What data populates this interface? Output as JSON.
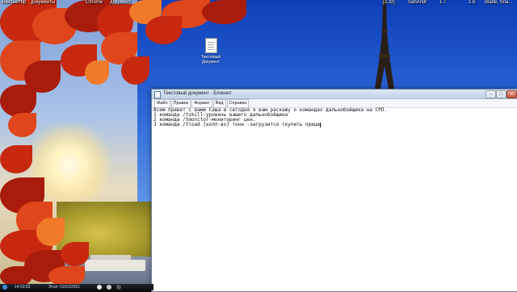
{
  "desktop": {
    "top_icons": [
      {
        "label": "компьютер"
      },
      {
        "label": "документы"
      },
      {
        "label": "Chrome"
      },
      {
        "label": "документ"
      },
      {
        "label": "[3.3z]"
      },
      {
        "label": "SanAndr"
      },
      {
        "label": "1.7"
      },
      {
        "label": "1.6"
      },
      {
        "label": "Blade, Sna..."
      }
    ],
    "file_icon": {
      "label_line1": "Текстовый",
      "label_line2": "Документ"
    }
  },
  "notepad": {
    "title": "Текстовый документ - Блокнот",
    "buttons": {
      "minimize": "–",
      "maximize": "□",
      "close": "x"
    },
    "menu": [
      "Файл",
      "Правка",
      "Формат",
      "Вид",
      "Справка"
    ],
    "lines": [
      "Всем привет с вами Саша и сегодня я вам раскажу о командах дальнобойщика на СРП.",
      "1 команда /tskill-уровень вашего дальнобойщика",
      "2 команда /tmonitor-мониторинг цен.",
      "3 команда /tload [колл-во] тонн -загрузится (купить прице"
    ]
  },
  "taskbar": {
    "time": "14:53:03",
    "status": "Этап: 01/01/2021"
  }
}
